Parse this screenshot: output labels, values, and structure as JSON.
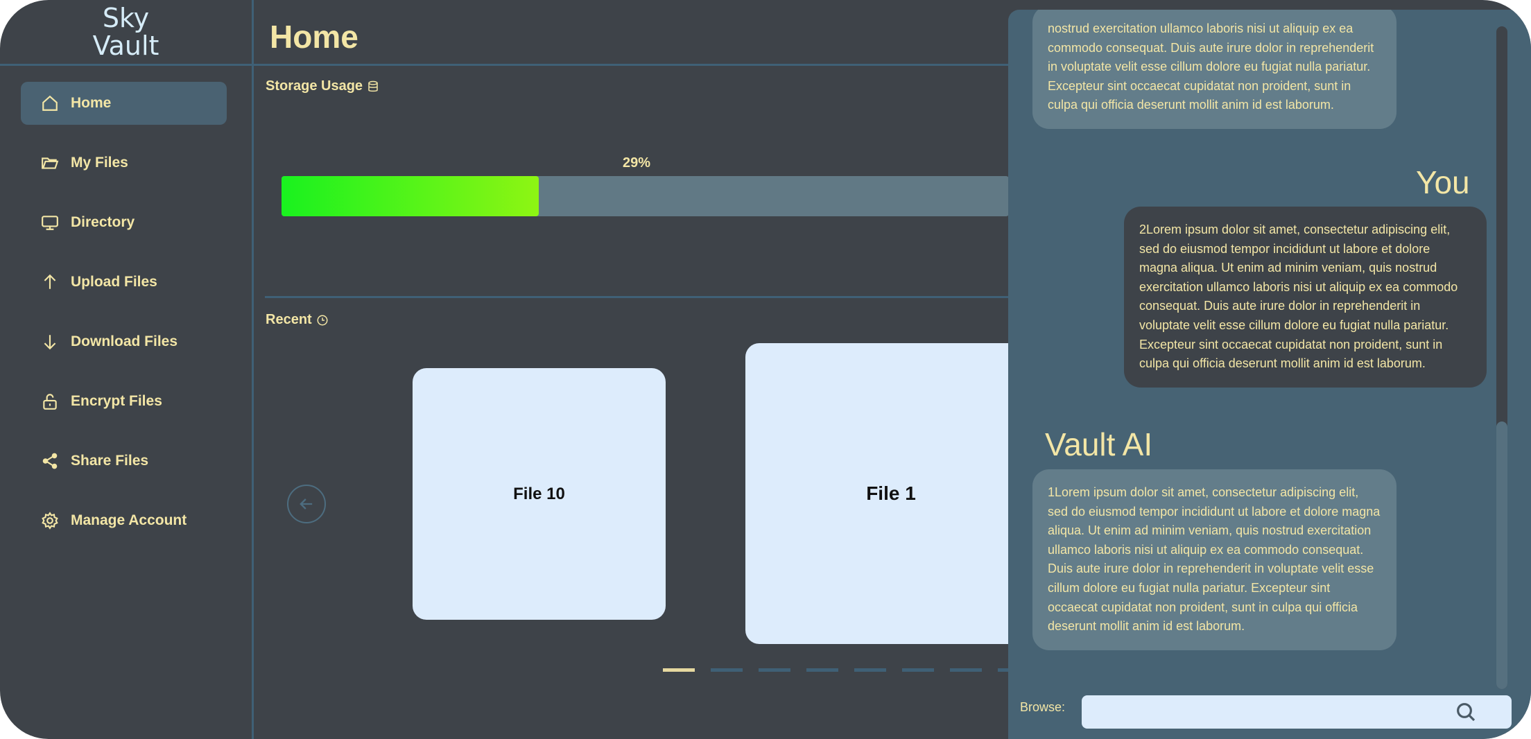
{
  "brand": {
    "line1": "Sky",
    "line2": "Vault"
  },
  "sidebar": {
    "items": [
      {
        "label": "Home",
        "icon": "home-icon",
        "active": true
      },
      {
        "label": "My Files",
        "icon": "folder-icon"
      },
      {
        "label": "Directory",
        "icon": "monitor-icon"
      },
      {
        "label": "Upload Files",
        "icon": "arrow-up-icon"
      },
      {
        "label": "Download Files",
        "icon": "arrow-down-icon"
      },
      {
        "label": "Encrypt Files",
        "icon": "lock-icon"
      },
      {
        "label": "Share Files",
        "icon": "share-icon"
      },
      {
        "label": "Manage Account",
        "icon": "gear-icon"
      }
    ]
  },
  "main": {
    "title": "Home",
    "storage": {
      "label": "Storage Usage",
      "percent_text": "29%",
      "fraction": 0.29
    },
    "recent": {
      "label": "Recent",
      "files": [
        "File 10",
        "File 1"
      ],
      "pager": {
        "count": 8,
        "active": 0
      }
    }
  },
  "chat": {
    "messages": [
      {
        "sender": "",
        "text": "nostrud exercitation ullamco laboris nisi ut aliquip ex ea commodo consequat. Duis aute irure dolor in reprehenderit in voluptate velit esse cillum dolore eu fugiat nulla pariatur. Excepteur sint occaecat cupidatat non proident, sunt in culpa qui officia deserunt mollit anim id est laborum."
      },
      {
        "sender": "You",
        "text": "2Lorem ipsum dolor sit amet, consectetur adipiscing elit, sed do eiusmod tempor incididunt ut labore et dolore magna aliqua. Ut enim ad minim veniam, quis nostrud exercitation ullamco laboris nisi ut aliquip ex ea commodo consequat. Duis aute irure dolor in reprehenderit in voluptate velit esse cillum dolore eu fugiat nulla pariatur. Excepteur sint occaecat cupidatat non proident, sunt in culpa qui officia deserunt mollit anim id est laborum."
      },
      {
        "sender": "Vault AI",
        "text": "1Lorem ipsum dolor sit amet, consectetur adipiscing elit, sed do eiusmod tempor incididunt ut labore et dolore magna aliqua. Ut enim ad minim veniam, quis nostrud exercitation ullamco laboris nisi ut aliquip ex ea commodo consequat. Duis aute irure dolor in reprehenderit in voluptate velit esse cillum dolore eu fugiat nulla pariatur. Excepteur sint occaecat cupidatat non proident, sunt in culpa qui officia deserunt mollit anim id est laborum."
      }
    ],
    "browse": {
      "label": "Browse:",
      "value": "",
      "placeholder": ""
    }
  },
  "colors": {
    "background": "#3e4349",
    "accent_text": "#f3e6a6",
    "border": "#3f6076",
    "chat_panel": "#476374",
    "card": "#ddecfc",
    "progress_start": "#19f21f",
    "progress_end": "#8ef513"
  }
}
